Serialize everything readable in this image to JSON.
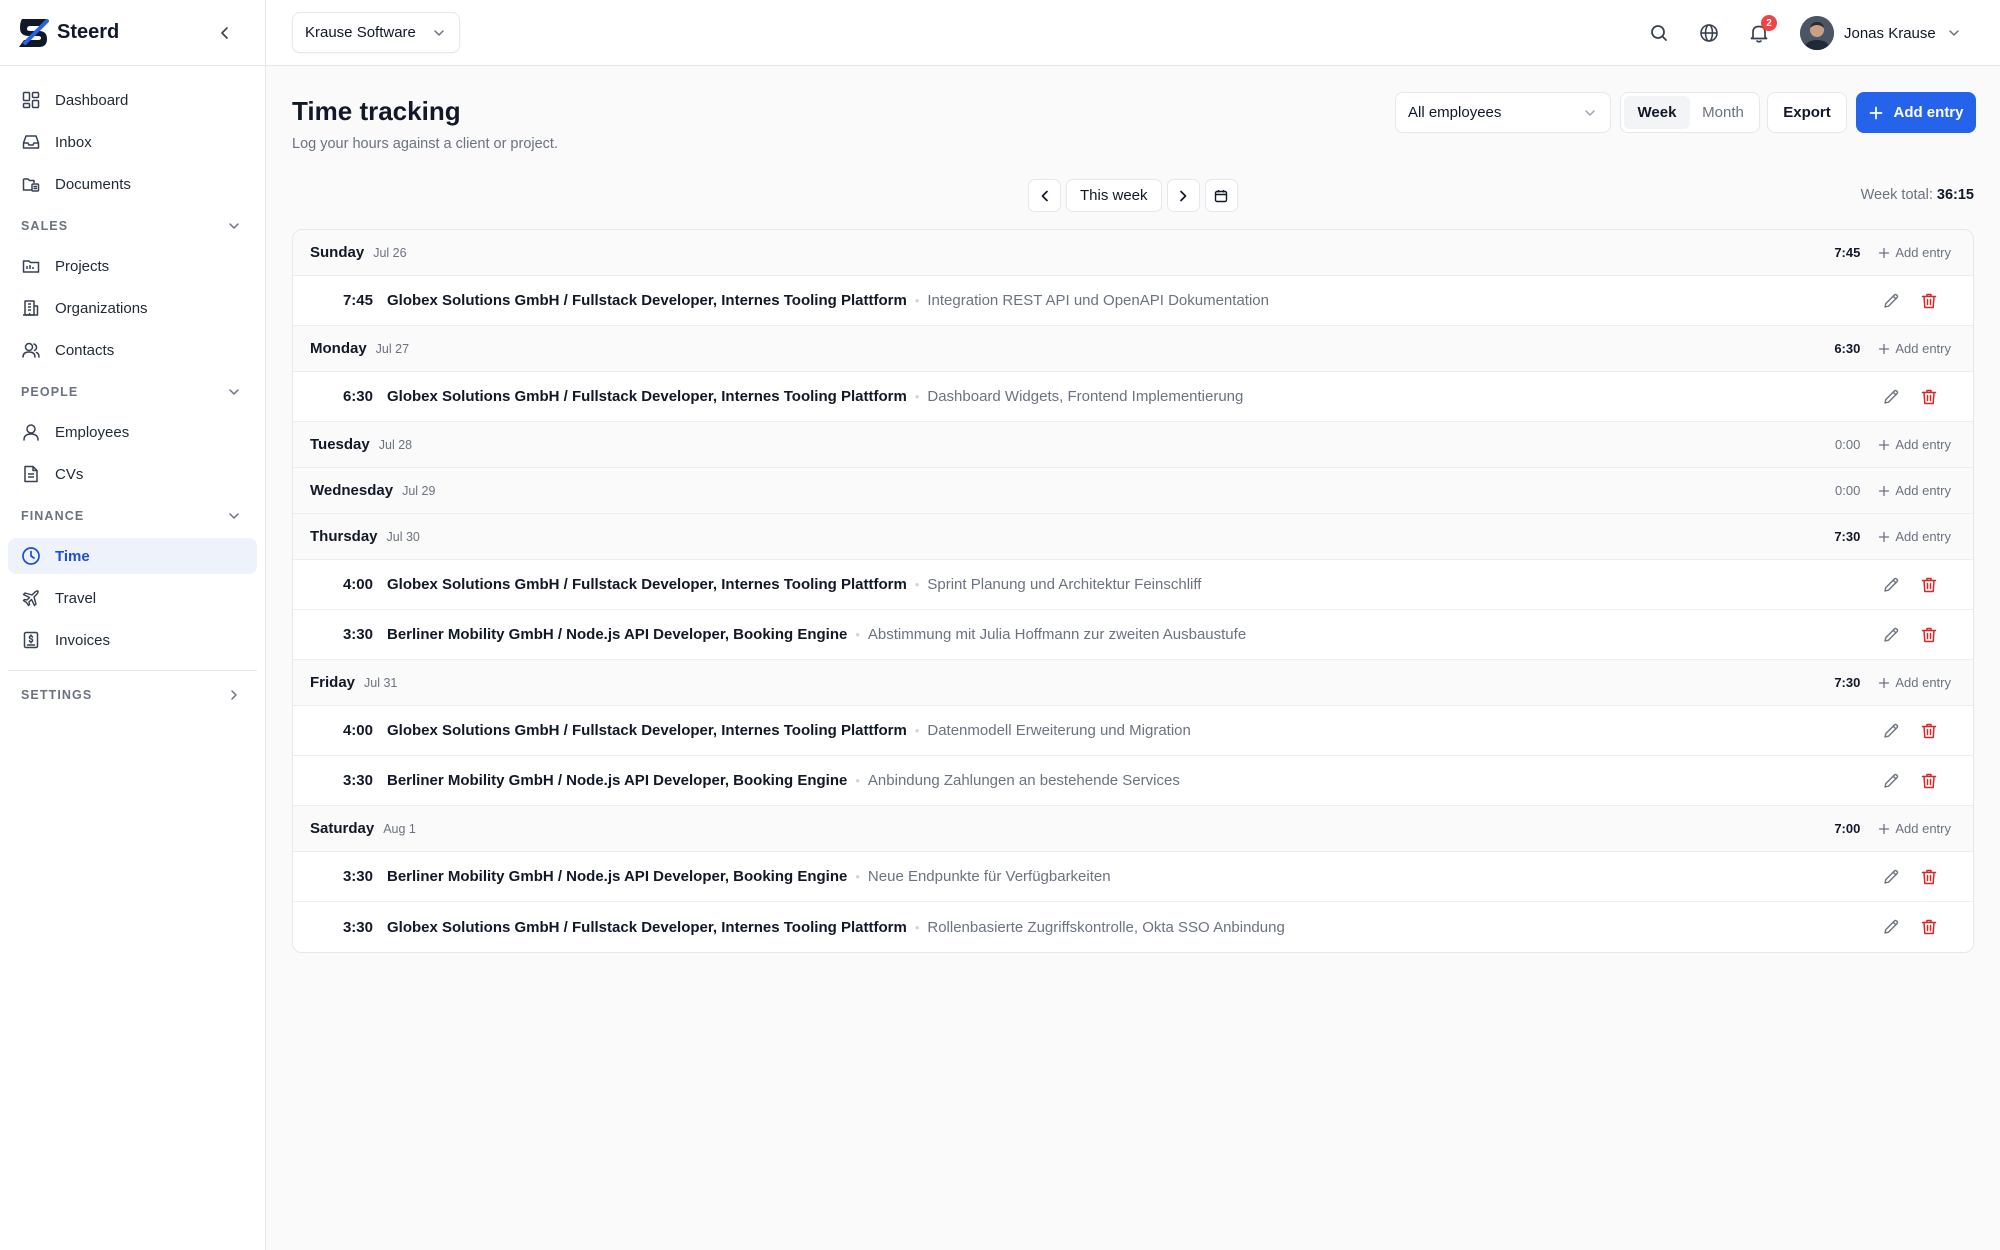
{
  "brand": {
    "name": "Steerd"
  },
  "nav": {
    "top": [
      {
        "label": "Dashboard",
        "icon": "dashboard-icon"
      },
      {
        "label": "Inbox",
        "icon": "inbox-icon"
      },
      {
        "label": "Documents",
        "icon": "documents-icon"
      }
    ],
    "sales": {
      "title": "SALES",
      "items": [
        {
          "label": "Projects",
          "icon": "folder-icon"
        },
        {
          "label": "Organizations",
          "icon": "building-icon"
        },
        {
          "label": "Contacts",
          "icon": "contacts-icon"
        }
      ]
    },
    "people": {
      "title": "PEOPLE",
      "items": [
        {
          "label": "Employees",
          "icon": "user-icon"
        },
        {
          "label": "CVs",
          "icon": "file-icon"
        }
      ]
    },
    "finance": {
      "title": "FINANCE",
      "items": [
        {
          "label": "Time",
          "icon": "clock-icon",
          "active": true
        },
        {
          "label": "Travel",
          "icon": "plane-icon"
        },
        {
          "label": "Invoices",
          "icon": "invoice-icon"
        }
      ]
    },
    "settings": {
      "title": "SETTINGS"
    }
  },
  "topbar": {
    "org": "Krause Software",
    "notifications": "2",
    "user": "Jonas Krause"
  },
  "page": {
    "title": "Time tracking",
    "subtitle": "Log your hours against a client or project.",
    "employee_filter": "All employees",
    "view_week": "Week",
    "view_month": "Month",
    "export": "Export",
    "add_entry": "Add entry",
    "this_week": "This week",
    "week_total_label": "Week total:",
    "week_total": "36:15"
  },
  "colors": {
    "accent": "#2563eb",
    "danger": "#dc2626",
    "active_bg": "#eef2fb"
  },
  "days": [
    {
      "name": "Sunday",
      "date": "Jul 26",
      "total": "7:45",
      "add": "Add entry",
      "entries": [
        {
          "dur": "7:45",
          "client": "Globex Solutions GmbH / Fullstack Developer, Internes Tooling Plattform",
          "desc": "Integration REST API und OpenAPI Dokumentation"
        }
      ]
    },
    {
      "name": "Monday",
      "date": "Jul 27",
      "total": "6:30",
      "add": "Add entry",
      "entries": [
        {
          "dur": "6:30",
          "client": "Globex Solutions GmbH / Fullstack Developer, Internes Tooling Plattform",
          "desc": "Dashboard Widgets, Frontend Implementierung"
        }
      ]
    },
    {
      "name": "Tuesday",
      "date": "Jul 28",
      "total": "0:00",
      "add": "Add entry",
      "entries": []
    },
    {
      "name": "Wednesday",
      "date": "Jul 29",
      "total": "0:00",
      "add": "Add entry",
      "entries": []
    },
    {
      "name": "Thursday",
      "date": "Jul 30",
      "total": "7:30",
      "add": "Add entry",
      "entries": [
        {
          "dur": "4:00",
          "client": "Globex Solutions GmbH / Fullstack Developer, Internes Tooling Plattform",
          "desc": "Sprint Planung und Architektur Feinschliff"
        },
        {
          "dur": "3:30",
          "client": "Berliner Mobility GmbH / Node.js API Developer, Booking Engine",
          "desc": "Abstimmung mit Julia Hoffmann zur zweiten Ausbaustufe"
        }
      ]
    },
    {
      "name": "Friday",
      "date": "Jul 31",
      "total": "7:30",
      "add": "Add entry",
      "entries": [
        {
          "dur": "4:00",
          "client": "Globex Solutions GmbH / Fullstack Developer, Internes Tooling Plattform",
          "desc": "Datenmodell Erweiterung und Migration"
        },
        {
          "dur": "3:30",
          "client": "Berliner Mobility GmbH / Node.js API Developer, Booking Engine",
          "desc": "Anbindung Zahlungen an bestehende Services"
        }
      ]
    },
    {
      "name": "Saturday",
      "date": "Aug 1",
      "total": "7:00",
      "add": "Add entry",
      "entries": [
        {
          "dur": "3:30",
          "client": "Berliner Mobility GmbH / Node.js API Developer, Booking Engine",
          "desc": "Neue Endpunkte für Verfügbarkeiten"
        },
        {
          "dur": "3:30",
          "client": "Globex Solutions GmbH / Fullstack Developer, Internes Tooling Plattform",
          "desc": "Rollenbasierte Zugriffskontrolle, Okta SSO Anbindung"
        }
      ]
    }
  ]
}
